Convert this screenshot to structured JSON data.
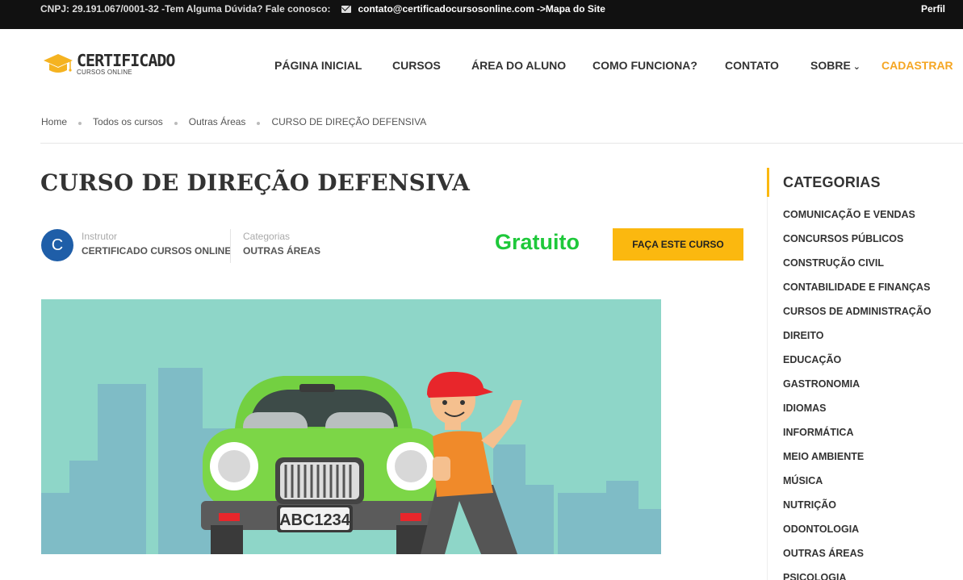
{
  "topbar": {
    "cnpj_text": "CNPJ: 29.191.067/0001-32 -Tem Alguma Dúvida? Fale conosco:",
    "email": "contato@certificadocursosonline.com",
    "map_link": "->Mapa do Site",
    "profile": "Perfil"
  },
  "logo": {
    "title": "CERTIFICADO",
    "subtitle": "CURSOS ONLINE"
  },
  "nav": {
    "items": [
      "PÁGINA INICIAL",
      "CURSOS",
      "ÁREA DO ALUNO",
      "COMO FUNCIONA?",
      "CONTATO",
      "SOBRE"
    ],
    "register": "CADASTRAR"
  },
  "breadcrumb": [
    "Home",
    "Todos os cursos",
    "Outras Áreas",
    "CURSO DE DIREÇÃO DEFENSIVA"
  ],
  "course": {
    "title": "CURSO DE DIREÇÃO DEFENSIVA",
    "avatar_letter": "C",
    "instructor_label": "Instrutor",
    "instructor_value": "CERTIFICADO CURSOS ONLINE",
    "category_label": "Categorias",
    "category_value": "OUTRAS ÁREAS",
    "price": "Gratuito",
    "cta": "FAÇA ESTE CURSO",
    "plate": "ABC1234"
  },
  "sidebar": {
    "title": "CATEGORIAS",
    "categories": [
      "COMUNICAÇÃO E VENDAS",
      "CONCURSOS PÚBLICOS",
      "CONSTRUÇÃO CIVIL",
      "CONTABILIDADE E FINANÇAS",
      "CURSOS DE ADMINISTRAÇÃO",
      "DIREITO",
      "EDUCAÇÃO",
      "GASTRONOMIA",
      "IDIOMAS",
      "INFORMÁTICA",
      "MEIO AMBIENTE",
      "MÚSICA",
      "NUTRIÇÃO",
      "ODONTOLOGIA",
      "OUTRAS ÁREAS",
      "PSICOLOGIA"
    ]
  },
  "colors": {
    "accent": "#fbb80f",
    "price": "#1ec83a",
    "topbar": "#111111",
    "register": "#f5a623"
  },
  "icons": [
    "mail-icon",
    "graduation-cap-icon",
    "chevron-down-icon"
  ]
}
